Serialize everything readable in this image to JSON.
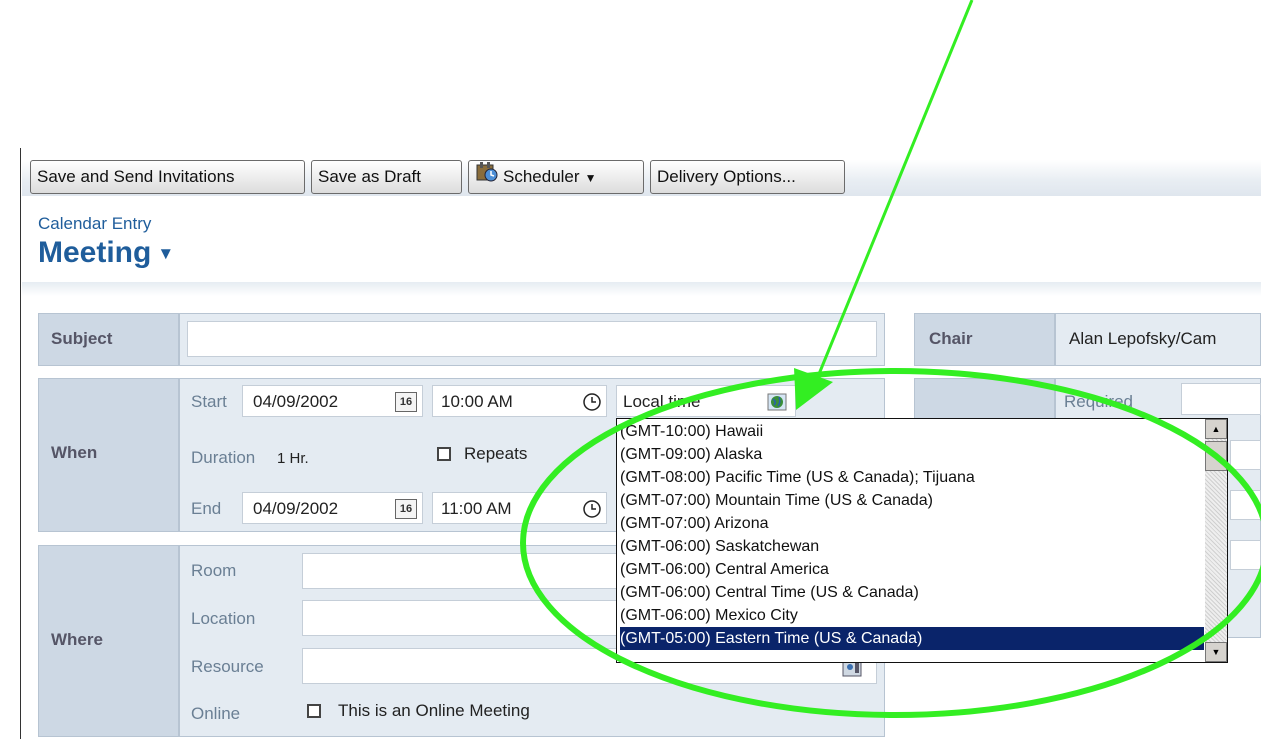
{
  "toolbar": {
    "save_send": "Save and Send Invitations",
    "save_draft": "Save as Draft",
    "scheduler": "Scheduler",
    "delivery_options": "Delivery Options..."
  },
  "form_kind": "Calendar Entry",
  "form_title": "Meeting",
  "subject": {
    "label": "Subject",
    "value": ""
  },
  "chair": {
    "label": "Chair",
    "value": "Alan Lepofsky/Cam"
  },
  "required_label": "Required",
  "when": {
    "label": "When",
    "start_label": "Start",
    "start_date": "04/09/2002",
    "start_time": "10:00 AM",
    "date_icon_text": "16",
    "timezone": "Local time",
    "duration_label": "Duration",
    "duration_value": "1 Hr.",
    "repeats_label": "Repeats",
    "end_label": "End",
    "end_date": "04/09/2002",
    "end_time": "11:00 AM"
  },
  "where": {
    "label": "Where",
    "room_label": "Room",
    "location_label": "Location",
    "resource_label": "Resource",
    "online_label": "Online",
    "online_checkbox_label": "This is an Online Meeting"
  },
  "timezone_options": [
    "(GMT-10:00) Hawaii",
    "(GMT-09:00) Alaska",
    "(GMT-08:00) Pacific Time (US & Canada); Tijuana",
    "(GMT-07:00) Mountain Time (US & Canada)",
    "(GMT-07:00) Arizona",
    "(GMT-06:00) Saskatchewan",
    "(GMT-06:00) Central America",
    "(GMT-06:00) Central Time (US & Canada)",
    "(GMT-06:00) Mexico City",
    "(GMT-05:00) Eastern Time (US & Canada)"
  ],
  "selected_timezone_index": 9,
  "colors": {
    "brand_blue": "#1f5d9b",
    "annotation_green": "#33ee22",
    "selection_bg": "#0a246a"
  },
  "icons": [
    "scheduler-icon",
    "calendar-icon",
    "clock-icon",
    "globe-icon",
    "address-book-icon",
    "scroll-up-icon",
    "scroll-down-icon"
  ]
}
